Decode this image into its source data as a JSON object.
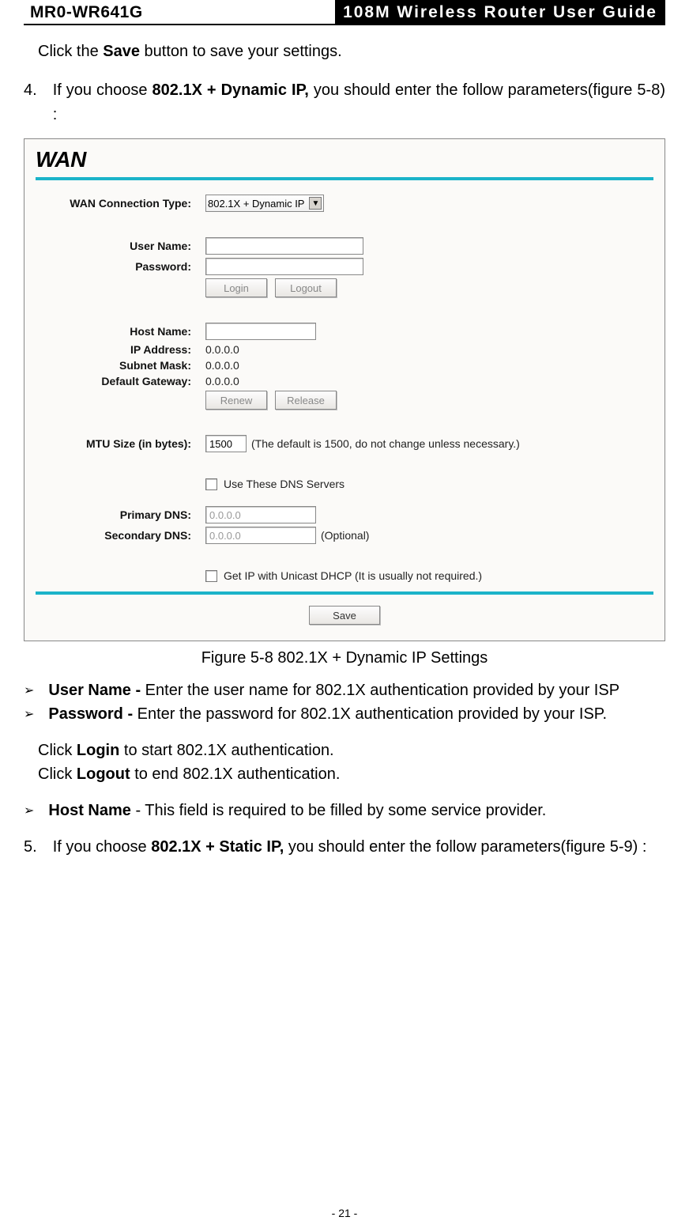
{
  "header": {
    "left": "MR0-WR641G",
    "right": "108M Wireless Router User Guide"
  },
  "intro": {
    "pre": "Click the ",
    "bold": "Save",
    "post": " button to save your settings."
  },
  "step4": {
    "num": "4.",
    "pre": "If you choose ",
    "bold": "802.1X + Dynamic IP,",
    "post": " you should enter the follow parameters(figure 5-8) :"
  },
  "wan": {
    "title": "WAN",
    "labels": {
      "conn": "WAN Connection Type:",
      "user": "User Name:",
      "pass": "Password:",
      "host": "Host Name:",
      "ip": "IP Address:",
      "mask": "Subnet Mask:",
      "gw": "Default Gateway:",
      "mtu": "MTU Size (in bytes):",
      "pdns": "Primary DNS:",
      "sdns": "Secondary DNS:"
    },
    "values": {
      "conn": "802.1X + Dynamic IP",
      "ip": "0.0.0.0",
      "mask": "0.0.0.0",
      "gw": "0.0.0.0",
      "mtu": "1500",
      "mtu_note": "(The default is 1500, do not change unless necessary.)",
      "pdns_placeholder": "0.0.0.0",
      "sdns_placeholder": "0.0.0.0",
      "sdns_opt": "(Optional)",
      "usedns": "Use These DNS Servers",
      "unicast": "Get IP with Unicast DHCP (It is usually not required.)"
    },
    "buttons": {
      "login": "Login",
      "logout": "Logout",
      "renew": "Renew",
      "release": "Release",
      "save": "Save"
    }
  },
  "caption": "Figure 5-8    802.1X + Dynamic IP Settings",
  "bullets": {
    "b1_lbl": "User Name -",
    "b1_txt": " Enter the user name for 802.1X authentication provided by your ISP",
    "b2_lbl": "Password -",
    "b2_txt": " Enter the password for 802.1X authentication provided by your ISP.",
    "b3_lbl": "Host Name",
    "b3_txt": " - This field is required to be filled by some service provider."
  },
  "clicks": {
    "l1a": "Click ",
    "l1b": "Login",
    "l1c": " to start 802.1X authentication.",
    "l2a": "Click ",
    "l2b": "Logout",
    "l2c": " to end 802.1X authentication."
  },
  "step5": {
    "num": "5.",
    "pre": "If you choose ",
    "bold": "802.1X + Static IP,",
    "post": " you should enter the follow parameters(figure 5-9) :"
  },
  "pagenum": "- 21 -",
  "glyph": "➢"
}
